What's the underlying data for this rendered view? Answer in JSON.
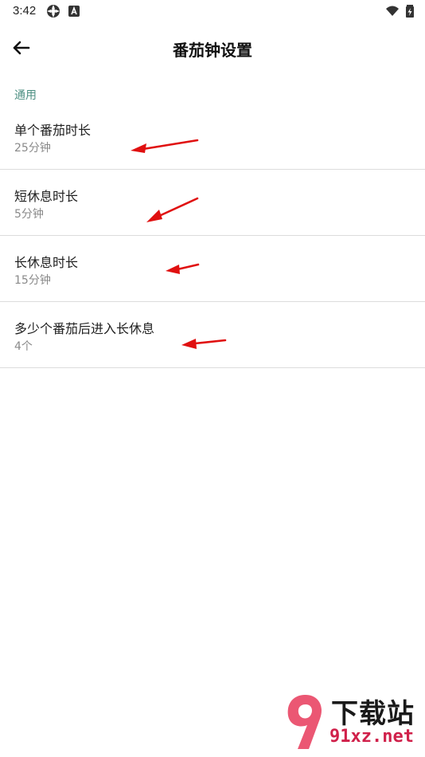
{
  "status_bar": {
    "time": "3:42"
  },
  "app_bar": {
    "title": "番茄钟设置",
    "back_icon": "arrow-left-icon"
  },
  "section": {
    "header": "通用"
  },
  "settings": [
    {
      "title": "单个番茄时长",
      "value": "25分钟"
    },
    {
      "title": "短休息时长",
      "value": "5分钟"
    },
    {
      "title": "长休息时长",
      "value": "15分钟"
    },
    {
      "title": "多少个番茄后进入长休息",
      "value": "4个"
    }
  ],
  "watermark": {
    "line1": "下载站",
    "line2": "91xz.net"
  },
  "colors": {
    "section_header": "#4c8f82",
    "annotation_arrow": "#e01010",
    "watermark_red": "#d0204a"
  }
}
